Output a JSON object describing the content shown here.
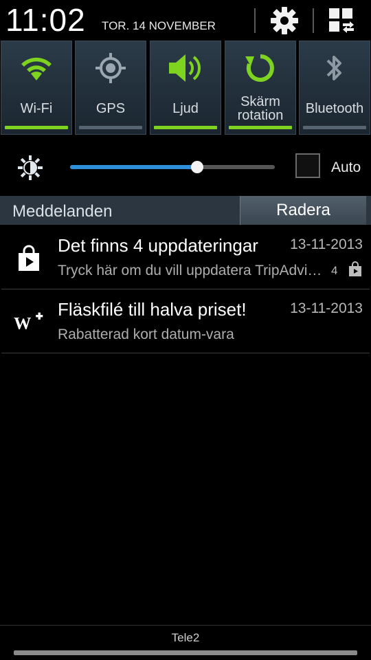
{
  "status": {
    "time": "11:02",
    "date": "TOR. 14 NOVEMBER"
  },
  "header_icons": {
    "settings": "gear-icon",
    "panel": "grid-switch-icon"
  },
  "toggles": [
    {
      "label": "Wi-Fi",
      "icon": "wifi-icon",
      "enabled": true
    },
    {
      "label": "GPS",
      "icon": "gps-icon",
      "enabled": false
    },
    {
      "label": "Ljud",
      "icon": "sound-icon",
      "enabled": true
    },
    {
      "label": "Skärm rotation",
      "label_line1": "Skärm",
      "label_line2": "rotation",
      "icon": "rotation-icon",
      "enabled": true
    },
    {
      "label": "Bluetooth",
      "icon": "bluetooth-icon",
      "enabled": false
    }
  ],
  "brightness": {
    "level_fraction": 0.62,
    "auto_label": "Auto",
    "auto_checked": false
  },
  "notifications_header": {
    "title": "Meddelanden",
    "clear_label": "Radera"
  },
  "notifications": [
    {
      "title": "Det finns 4 uppdateringar",
      "date": "13-11-2013",
      "text": "Tryck här om du vill uppdatera TripAdvisor",
      "count": "4",
      "icon": "play-store-icon"
    },
    {
      "title": "Fläskfilé till halva priset!",
      "date": "13-11-2013",
      "text": "Rabatterad kort datum-vara",
      "icon": "willys-plus-icon"
    }
  ],
  "carrier": "Tele2",
  "colors": {
    "accent_on": "#7ed321",
    "accent_off": "#556470",
    "slider_fill": "#2f8fd8"
  }
}
